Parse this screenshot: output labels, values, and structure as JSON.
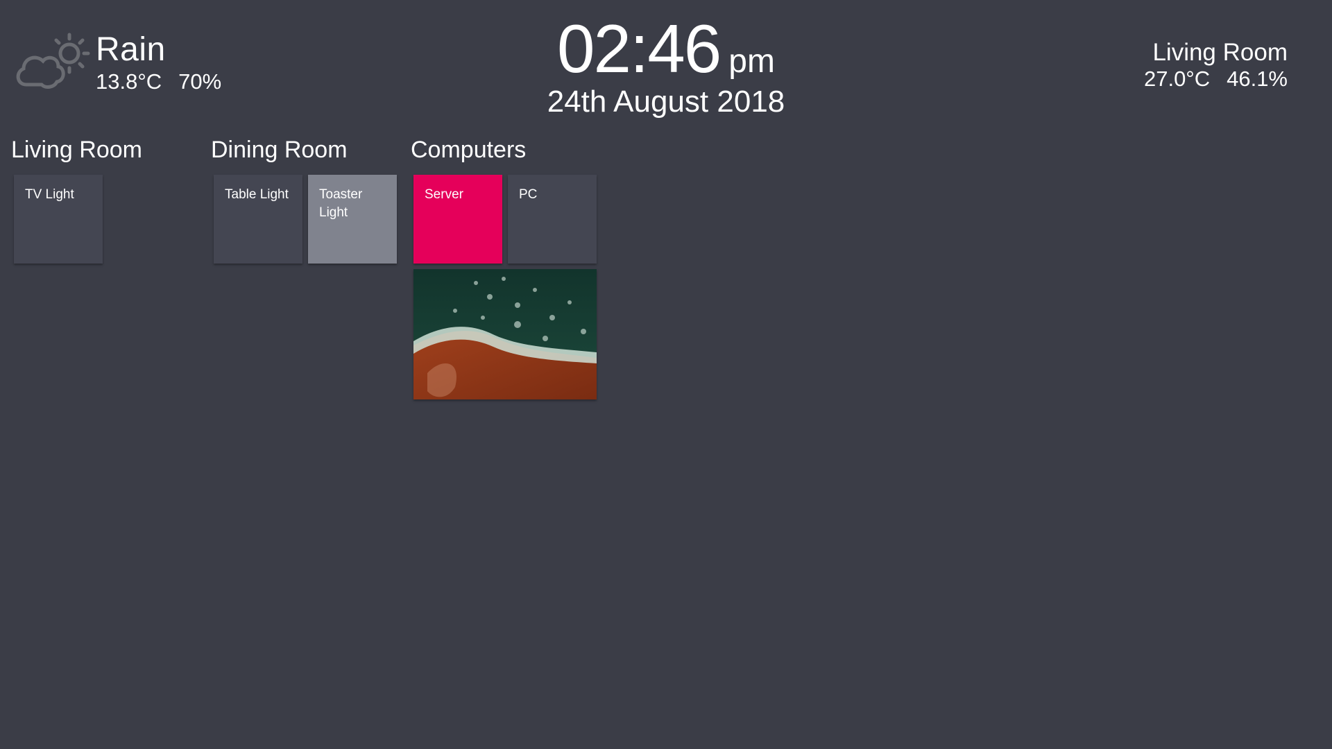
{
  "weather": {
    "condition": "Rain",
    "temperature": "13.8°C",
    "humidity": "70%",
    "icon": "partly-cloudy-sun-icon"
  },
  "clock": {
    "time": "02:46",
    "ampm": "pm",
    "date": "24th August 2018"
  },
  "sensor": {
    "name": "Living Room",
    "temperature": "27.0°C",
    "humidity": "46.1%"
  },
  "groups": [
    {
      "title": "Living Room",
      "tiles": [
        {
          "label": "TV Light",
          "state": "off"
        }
      ]
    },
    {
      "title": "Dining Room",
      "tiles": [
        {
          "label": "Table Light",
          "state": "off"
        },
        {
          "label": "Toaster Light",
          "state": "on"
        }
      ]
    },
    {
      "title": "Computers",
      "tiles": [
        {
          "label": "Server",
          "state": "on"
        },
        {
          "label": "PC",
          "state": "off"
        }
      ],
      "camera": {
        "icon": "camera-feed-image"
      }
    }
  ],
  "colors": {
    "background": "#3b3d47",
    "tile_off": "#444652",
    "tile_on_light": "#80838e",
    "tile_on_accent": "#e5005a",
    "text": "#ffffff"
  }
}
